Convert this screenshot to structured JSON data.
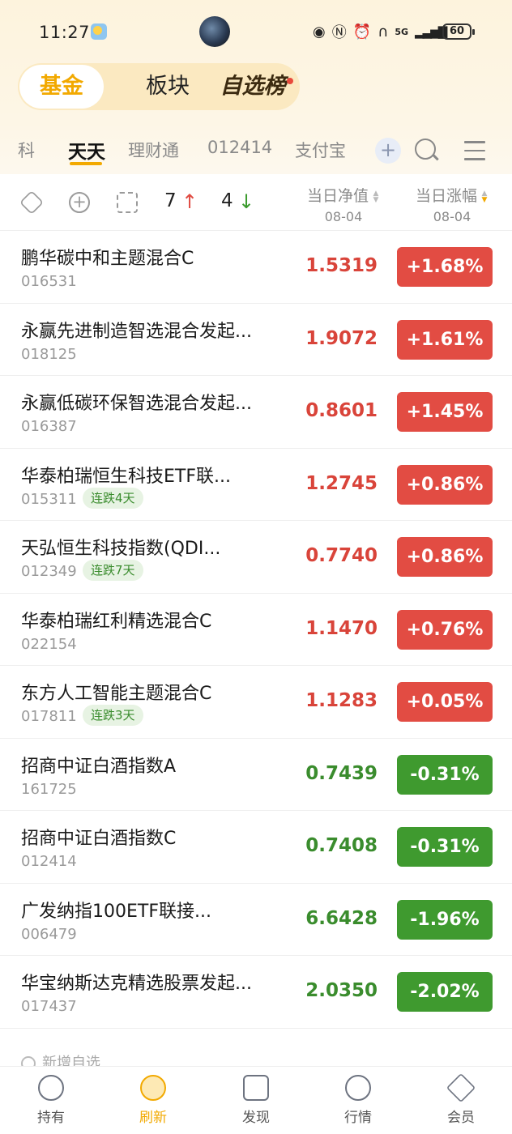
{
  "status_bar": {
    "time": "11:27",
    "battery": "60",
    "icons": [
      "eye-icon",
      "nfc-icon",
      "alarm-icon",
      "headphones-icon",
      "5g-signal-icon",
      "signal-icon"
    ]
  },
  "top_tabs": {
    "items": [
      "基金",
      "板块",
      "自选榜"
    ],
    "active": "基金"
  },
  "sub_tabs": {
    "items": [
      "科",
      "天天",
      "理财通",
      "012414",
      "支付宝"
    ],
    "active": "天天",
    "plus": "+"
  },
  "toolbar": {
    "up_count": "7",
    "down_count": "4",
    "up_arrow": "↑",
    "down_arrow": "↓",
    "col_nav_title": "当日净值",
    "col_nav_date": "08-04",
    "col_chg_title": "当日涨幅",
    "col_chg_date": "08-04"
  },
  "funds": [
    {
      "name": "鹏华碳中和主题混合C",
      "code": "016531",
      "badge": "",
      "nav": "1.5319",
      "change": "+1.68%",
      "dir": "up"
    },
    {
      "name": "永赢先进制造智选混合发起...",
      "code": "018125",
      "badge": "",
      "nav": "1.9072",
      "change": "+1.61%",
      "dir": "up"
    },
    {
      "name": "永赢低碳环保智选混合发起...",
      "code": "016387",
      "badge": "",
      "nav": "0.8601",
      "change": "+1.45%",
      "dir": "up"
    },
    {
      "name": "华泰柏瑞恒生科技ETF联...",
      "code": "015311",
      "badge": "连跌4天",
      "nav": "1.2745",
      "change": "+0.86%",
      "dir": "up"
    },
    {
      "name": "天弘恒生科技指数(QDI...",
      "code": "012349",
      "badge": "连跌7天",
      "nav": "0.7740",
      "change": "+0.86%",
      "dir": "up"
    },
    {
      "name": "华泰柏瑞红利精选混合C",
      "code": "022154",
      "badge": "",
      "nav": "1.1470",
      "change": "+0.76%",
      "dir": "up"
    },
    {
      "name": "东方人工智能主题混合C",
      "code": "017811",
      "badge": "连跌3天",
      "nav": "1.1283",
      "change": "+0.05%",
      "dir": "up"
    },
    {
      "name": "招商中证白酒指数A",
      "code": "161725",
      "badge": "",
      "nav": "0.7439",
      "change": "-0.31%",
      "dir": "down"
    },
    {
      "name": "招商中证白酒指数C",
      "code": "012414",
      "badge": "",
      "nav": "0.7408",
      "change": "-0.31%",
      "dir": "down"
    },
    {
      "name": "广发纳指100ETF联接...",
      "code": "006479",
      "badge": "",
      "nav": "6.6428",
      "change": "-1.96%",
      "dir": "down"
    },
    {
      "name": "华宝纳斯达克精选股票发起...",
      "code": "017437",
      "badge": "",
      "nav": "2.0350",
      "change": "-2.02%",
      "dir": "down"
    }
  ],
  "add_more": "新增自选",
  "bottom_nav": {
    "items": [
      {
        "label": "持有",
        "icon": "holdings-icon"
      },
      {
        "label": "刷新",
        "icon": "refresh-icon"
      },
      {
        "label": "发现",
        "icon": "discover-icon"
      },
      {
        "label": "行情",
        "icon": "market-icon"
      },
      {
        "label": "会员",
        "icon": "vip-diamond-icon"
      }
    ],
    "active": "刷新"
  },
  "colors": {
    "accent": "#f2a900",
    "up": "#e24c43",
    "down": "#3f9a2f"
  }
}
